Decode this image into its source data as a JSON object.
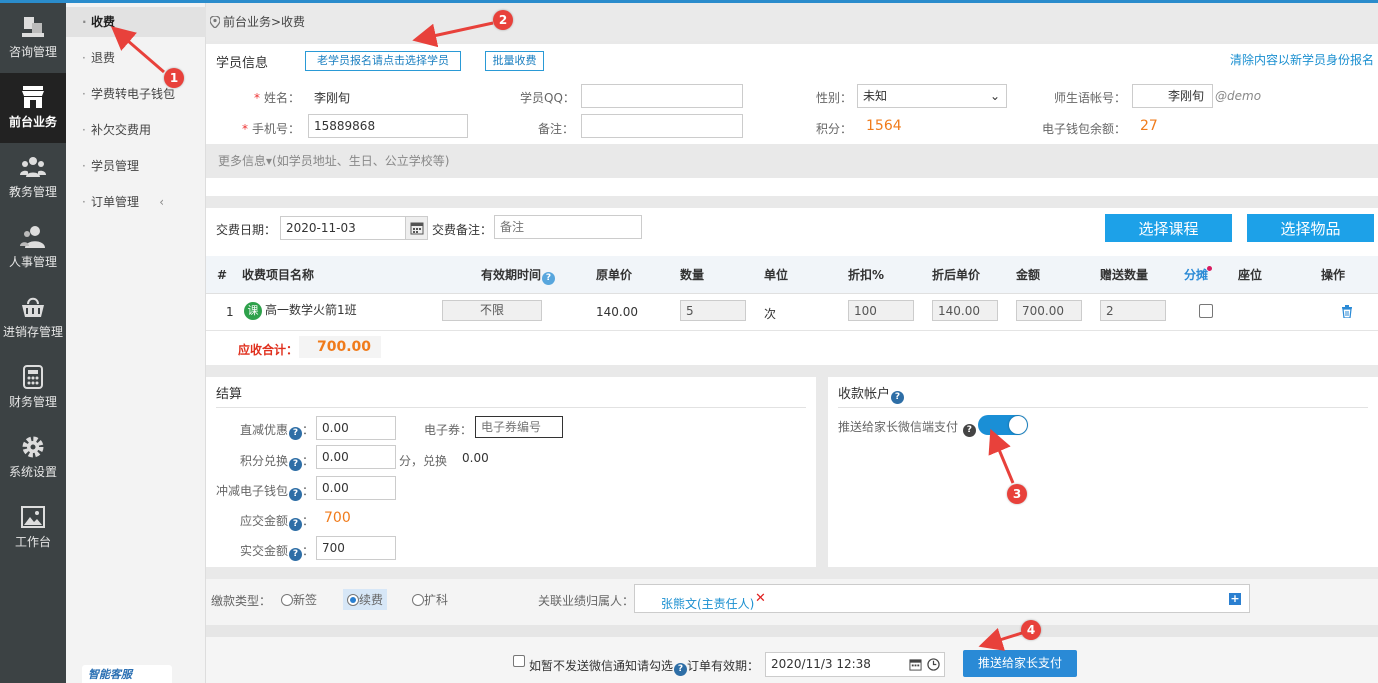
{
  "nav": {
    "items": [
      {
        "label": "咨询管理",
        "icon": "consult-icon"
      },
      {
        "label": "前台业务",
        "icon": "store-icon"
      },
      {
        "label": "教务管理",
        "icon": "group-icon"
      },
      {
        "label": "人事管理",
        "icon": "people-icon"
      },
      {
        "label": "进销存管理",
        "icon": "basket-icon"
      },
      {
        "label": "财务管理",
        "icon": "calculator-icon"
      },
      {
        "label": "系统设置",
        "icon": "gear-icon"
      },
      {
        "label": "工作台",
        "icon": "image-icon"
      }
    ],
    "active_index": 1
  },
  "submenu": {
    "items": [
      "收费",
      "退费",
      "学费转电子钱包",
      "补欠交费用",
      "学员管理",
      "订单管理"
    ],
    "active_index": 0,
    "footer_logo": "智能客服"
  },
  "breadcrumb": "前台业务>收费",
  "student": {
    "section_title": "学员信息",
    "select_old_btn": "老学员报名请点击选择学员",
    "batch_btn": "批量收费",
    "clear_link": "清除内容以新学员身份报名",
    "name_label": "姓名：",
    "name_value": "李刚旬",
    "qq_label": "学员QQ：",
    "qq_value": "",
    "gender_label": "性别：",
    "gender_value": "未知",
    "account_label": "师生语帐号：",
    "account_value": "李刚旬",
    "account_suffix": "@demo",
    "phone_label": "手机号：",
    "phone_value": "15889868",
    "remark_label": "备注：",
    "remark_value": "",
    "points_label": "积分：",
    "points_value": "1564",
    "wallet_label": "电子钱包余额：",
    "wallet_value": "27",
    "more_info": "更多信息▾(如学员地址、生日、公立学校等)"
  },
  "order": {
    "date_label": "交费日期：",
    "date_value": "2020-11-03",
    "note_label": "交费备注：",
    "note_placeholder": "备注",
    "choose_course_btn": "选择课程",
    "choose_goods_btn": "选择物品",
    "headers": [
      "#",
      "收费项目名称",
      "有效期时间",
      "原单价",
      "数量",
      "单位",
      "折扣%",
      "折后单价",
      "金额",
      "赠送数量",
      "分摊",
      "座位",
      "操作"
    ],
    "row": {
      "index": "1",
      "badge": "课",
      "name": "高一数学火箭1班",
      "validity": "不限",
      "unit_price": "140.00",
      "quantity": "5",
      "unit": "次",
      "discount": "100",
      "discounted_price": "140.00",
      "amount": "700.00",
      "gift_qty": "2"
    },
    "total_label": "应收合计：",
    "total_value": "700.00"
  },
  "settle": {
    "title": "结算",
    "direct_discount_label": "直减优惠",
    "direct_discount_value": "0.00",
    "coupon_label": "电子券：",
    "coupon_placeholder": "电子券编号",
    "points_exchange_label": "积分兑换",
    "points_exchange_value": "0.00",
    "points_unit": "分，兑换",
    "points_exchange_result": "0.00",
    "wallet_offset_label": "冲减电子钱包",
    "wallet_offset_value": "0.00",
    "due_label": "应交金额",
    "due_value": "700",
    "paid_label": "实交金额",
    "paid_value": "700",
    "colon": "："
  },
  "account": {
    "title": "收款帐户",
    "push_label": "推送给家长微信端支付",
    "toggle_on": true
  },
  "paytype": {
    "label": "缴款类型：",
    "options": [
      "新签",
      "续费",
      "扩科"
    ],
    "selected_index": 1,
    "assoc_label": "关联业绩归属人：",
    "assoc_person": "张熊文(主责任人)",
    "remove_mark": "✕",
    "add_mark": "+"
  },
  "footer": {
    "no_wechat_label": "如暂不发送微信通知请勾选",
    "expiry_label": "订单有效期：",
    "expiry_value": "2020/11/3 12:38",
    "submit_btn": "推送给家长支付"
  },
  "annotations": [
    "1",
    "2",
    "3",
    "4"
  ],
  "colors": {
    "accent": "#1da1e8",
    "nav_bg": "#3c4244",
    "orange": "#f07b1b",
    "annotation": "#e8413b"
  }
}
